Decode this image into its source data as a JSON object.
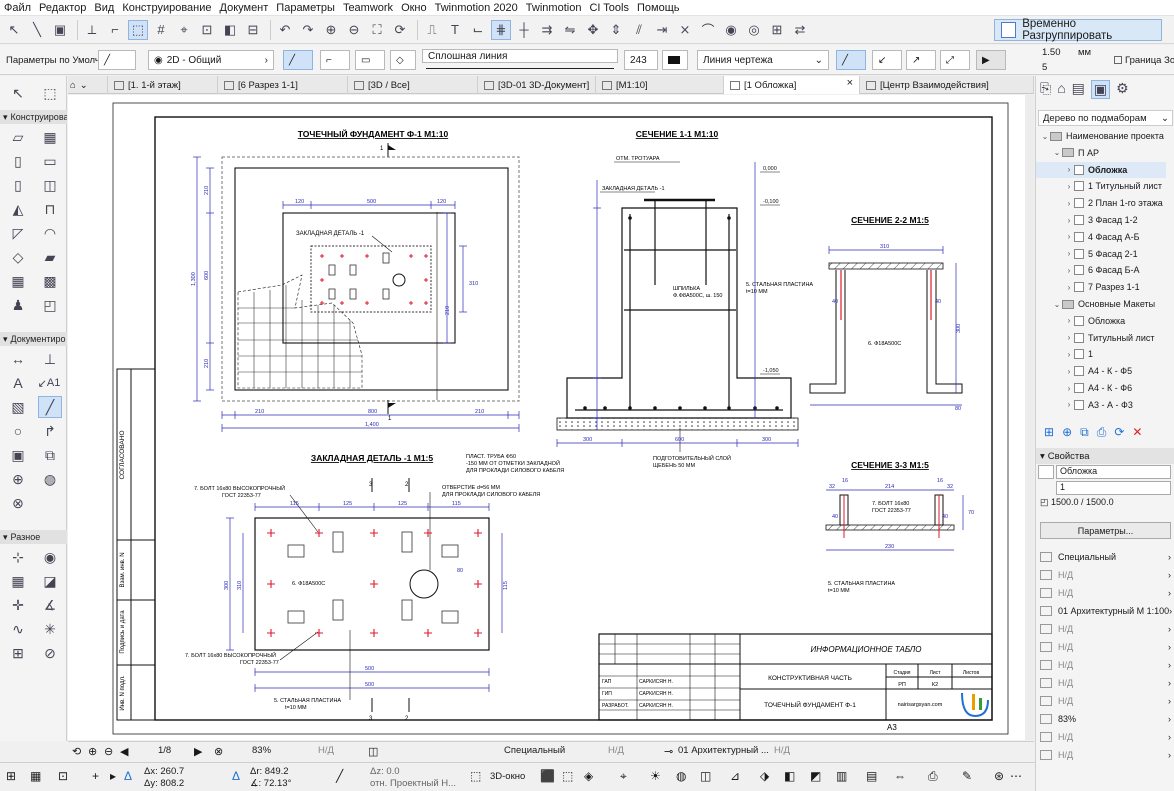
{
  "menu": [
    "Файл",
    "Редактор",
    "Вид",
    "Конструирование",
    "Документ",
    "Параметры",
    "Teamwork",
    "Окно",
    "Twinmotion 2020",
    "Twinmotion",
    "CI Tools",
    "Помощь"
  ],
  "toolbar": {
    "temp_unblock_label": "Временно Разгруппировать"
  },
  "infobox": {
    "preset": "Параметры по Умолчанию",
    "layer": "2D - Общий",
    "line_type": "Сплошная линия",
    "pen_number": "243",
    "line_category": "Линия чертежа",
    "size_value": "1.50",
    "size_unit": "мм",
    "size_value_2": "5",
    "size_ratio": "1500.0 / 1500.0",
    "border_zone_label": "Граница Зоны"
  },
  "tabs": [
    {
      "label": "[1. 1-й этаж]",
      "icon": "floorplan-icon"
    },
    {
      "label": "[6 Разрез 1-1]",
      "icon": "section-icon"
    },
    {
      "label": "[3D / Все]",
      "icon": "3d-icon"
    },
    {
      "label": "[3D-01 3D-Документ]",
      "icon": "3d-document-icon"
    },
    {
      "label": "[M1:10]",
      "icon": "detail-icon"
    },
    {
      "label": "[1 Обложка]",
      "icon": "layout-icon"
    },
    {
      "label": "[Центр Взаимодействия]",
      "icon": "collaboration-icon"
    }
  ],
  "toolbox": {
    "header_construct": "Конструирова",
    "header_document": "Документиро",
    "header_misc": "Разное",
    "a1_label": "A1"
  },
  "drawing": {
    "title_foundation": "ТОЧЕЧНЫЙ ФУНДАМЕНТ Ф-1 М1:10",
    "title_section11": "СЕЧЕНИЕ  1-1 М1:10",
    "title_section22": "СЕЧЕНИЕ  2-2 М1:5",
    "title_section33": "СЕЧЕНИЕ  3-3 М1:5",
    "title_embedded": "ЗАКЛАДНАЯ ДЕТАЛЬ -1  М1:5",
    "label_embedded_small": "ЗАКЛАДНАЯ ДЕТАЛЬ -1",
    "label_sidewalk": "ОТМ. ТРОТУАРА",
    "label_zakl": "ЗАКЛАДНАЯ ДЕТАЛЬ -1",
    "label_stud_1": "ШПИЛЬКА",
    "label_stud_2": "Ф.Ф8A500С, ш. 150",
    "label_plate_1": "5. СТАЛЬНАЯ ПЛАСТИНА",
    "label_plate_2": "t=10 MM",
    "label_rebar": "6. Ф18А500С",
    "label_gravel_1": "ПОДГОТОВИТЕЛЬНЫЙ СЛОЙ",
    "label_gravel_2": "ЩЕБЕНЬ 50 ММ",
    "label_pipe_1": "ПЛАСТ. ТРУБА Ф50",
    "label_pipe_2": "-150 ММ ОТ ОТМЕТКИ ЗАКЛАДНОЙ",
    "label_pipe_3": "ДЛЯ ПРОКЛАДИ СИЛОВОГО КАБЕЛЯ",
    "label_hole_1": "ОТВЕРСТИЕ d=56 MM",
    "label_hole_2": "ДЛЯ ПРОКЛАДИ СИЛОВОГО КАБЕЛЯ",
    "label_bolt_a1": "7. БОЛТ 16x80 ВЫСОКОПРОЧНЫЙ",
    "label_bolt_a2": "ГОСТ 22353-77",
    "label_bolt_b1": "7. БОЛТ 16x80 ВЫСОКОПРОЧНЫЙ",
    "label_bolt_b2": "ГОСТ 22353-77",
    "label_bolt_c1": "7. БОЛТ 16x80",
    "label_bolt_c2": "ГОСТ 22353-77",
    "label_rebar_emb": "6. Ф18А500С",
    "label_plate_emb_1": "5. СТАЛЬНАЯ ПЛАСТИНА",
    "label_plate_emb_2": "t=10 MM",
    "label_plate_33_1": "5. СТАЛЬНАЯ ПЛАСТИНА",
    "label_plate_33_2": "t=10 MM",
    "dims": {
      "d1400": "1,400",
      "d800": "800",
      "d300": "300",
      "d210": "210",
      "d600": "600",
      "d500": "500",
      "d400": "400",
      "d120": "120",
      "d115": "115",
      "d125": "125",
      "d214": "214",
      "d32": "32",
      "d16": "16",
      "d40": "40",
      "d230": "230",
      "d310": "310",
      "d80": "80",
      "d70": "70",
      "d1300": "1,300",
      "d0000": "0,000",
      "dm100": "-0,100",
      "dm1050": "-1,050"
    },
    "marks": {
      "m1": "1",
      "m2": "2",
      "m3": "3"
    },
    "vert_stamp": "СОГЛАСОВАНО",
    "vert_inv1": "Взам. инв. N",
    "vert_sign": "Подпись и дата",
    "vert_inv2": "Инв. N подл.",
    "stamp_title": "ИНФОРМАЦИОННОЕ ТАБЛО",
    "stamp_part": "КОНСТРУКТИВНАЯ ЧАСТЬ",
    "stamp_sheet_name": "ТОЧЕЧНЫЙ ФУНДАМЕНТ Ф-1",
    "stamp_stage_hdr": "Стадия",
    "stamp_sheet_hdr": "Лист",
    "stamp_sheets_hdr": "Листов",
    "stamp_stage": "РП",
    "stamp_sheet": "К2",
    "stamp_site": "nairisargsyan.com",
    "stamp_rows": [
      {
        "role": "ГАП",
        "name": "САРКИСЯН Н."
      },
      {
        "role": "ГИП",
        "name": "САРКИСЯН Н."
      },
      {
        "role": "РАЗРАБОТ.",
        "name": "САРКИСЯН Н."
      }
    ],
    "format": "А3"
  },
  "navigator": {
    "dropdown": "Дерево по подмаборам",
    "items": [
      {
        "label": "Наименование проекта",
        "level": 0,
        "type": "root"
      },
      {
        "label": "П АР",
        "level": 1,
        "type": "folder"
      },
      {
        "label": "Обложка",
        "level": 2,
        "type": "page",
        "selected": true
      },
      {
        "label": "1 Титульный лист",
        "level": 2,
        "type": "page"
      },
      {
        "label": "2 План 1-го этажа",
        "level": 2,
        "type": "page"
      },
      {
        "label": "3 Фасад 1-2",
        "level": 2,
        "type": "page"
      },
      {
        "label": "4 Фасад А-Б",
        "level": 2,
        "type": "page"
      },
      {
        "label": "5 Фасад 2-1",
        "level": 2,
        "type": "page"
      },
      {
        "label": "6 Фасад Б-А",
        "level": 2,
        "type": "page"
      },
      {
        "label": "7 Разрез 1-1",
        "level": 2,
        "type": "page"
      },
      {
        "label": "Основные Макеты",
        "level": 1,
        "type": "folder"
      },
      {
        "label": "Обложка",
        "level": 2,
        "type": "page"
      },
      {
        "label": "Титульный лист",
        "level": 2,
        "type": "page"
      },
      {
        "label": "1",
        "level": 2,
        "type": "page"
      },
      {
        "label": "А4 - К - Ф5",
        "level": 2,
        "type": "page"
      },
      {
        "label": "А4 - К - Ф6",
        "level": 2,
        "type": "page"
      },
      {
        "label": "А3 - А - Ф3",
        "level": 2,
        "type": "page"
      }
    ]
  },
  "properties": {
    "header": "Свойства",
    "name_value": "Обложка",
    "id_value": "1",
    "size_value": "1500.0 / 1500.0",
    "params_button": "Параметры...",
    "rows": [
      "Специальный",
      "Н/Д",
      "Н/Д",
      "01 Архитектурный М 1:100",
      "Н/Д",
      "Н/Д",
      "Н/Д",
      "Н/Д",
      "Н/Д",
      "83%",
      "Н/Д",
      "Н/Д"
    ]
  },
  "statusbar": {
    "page": "1/8",
    "zoom": "83%",
    "nd1": "Н/Д",
    "special": "Специальный",
    "nd2": "Н/Д",
    "arch": "01 Архитектурный ...",
    "nd3": "Н/Д"
  },
  "coords": {
    "dx": "Δx: 260.7",
    "dy": "Δy: 808.2",
    "dr": "Δr: 849.2",
    "da": "∡: 72.13°",
    "dz": "Δz: 0.0",
    "ref": "отн. Проектный Н...",
    "view3d": "3D-окно"
  },
  "colors": {
    "accent": "#1f6fd6",
    "dim": "#2a2ab8",
    "red": "#e0192b",
    "sel": "#cfe2f7"
  }
}
